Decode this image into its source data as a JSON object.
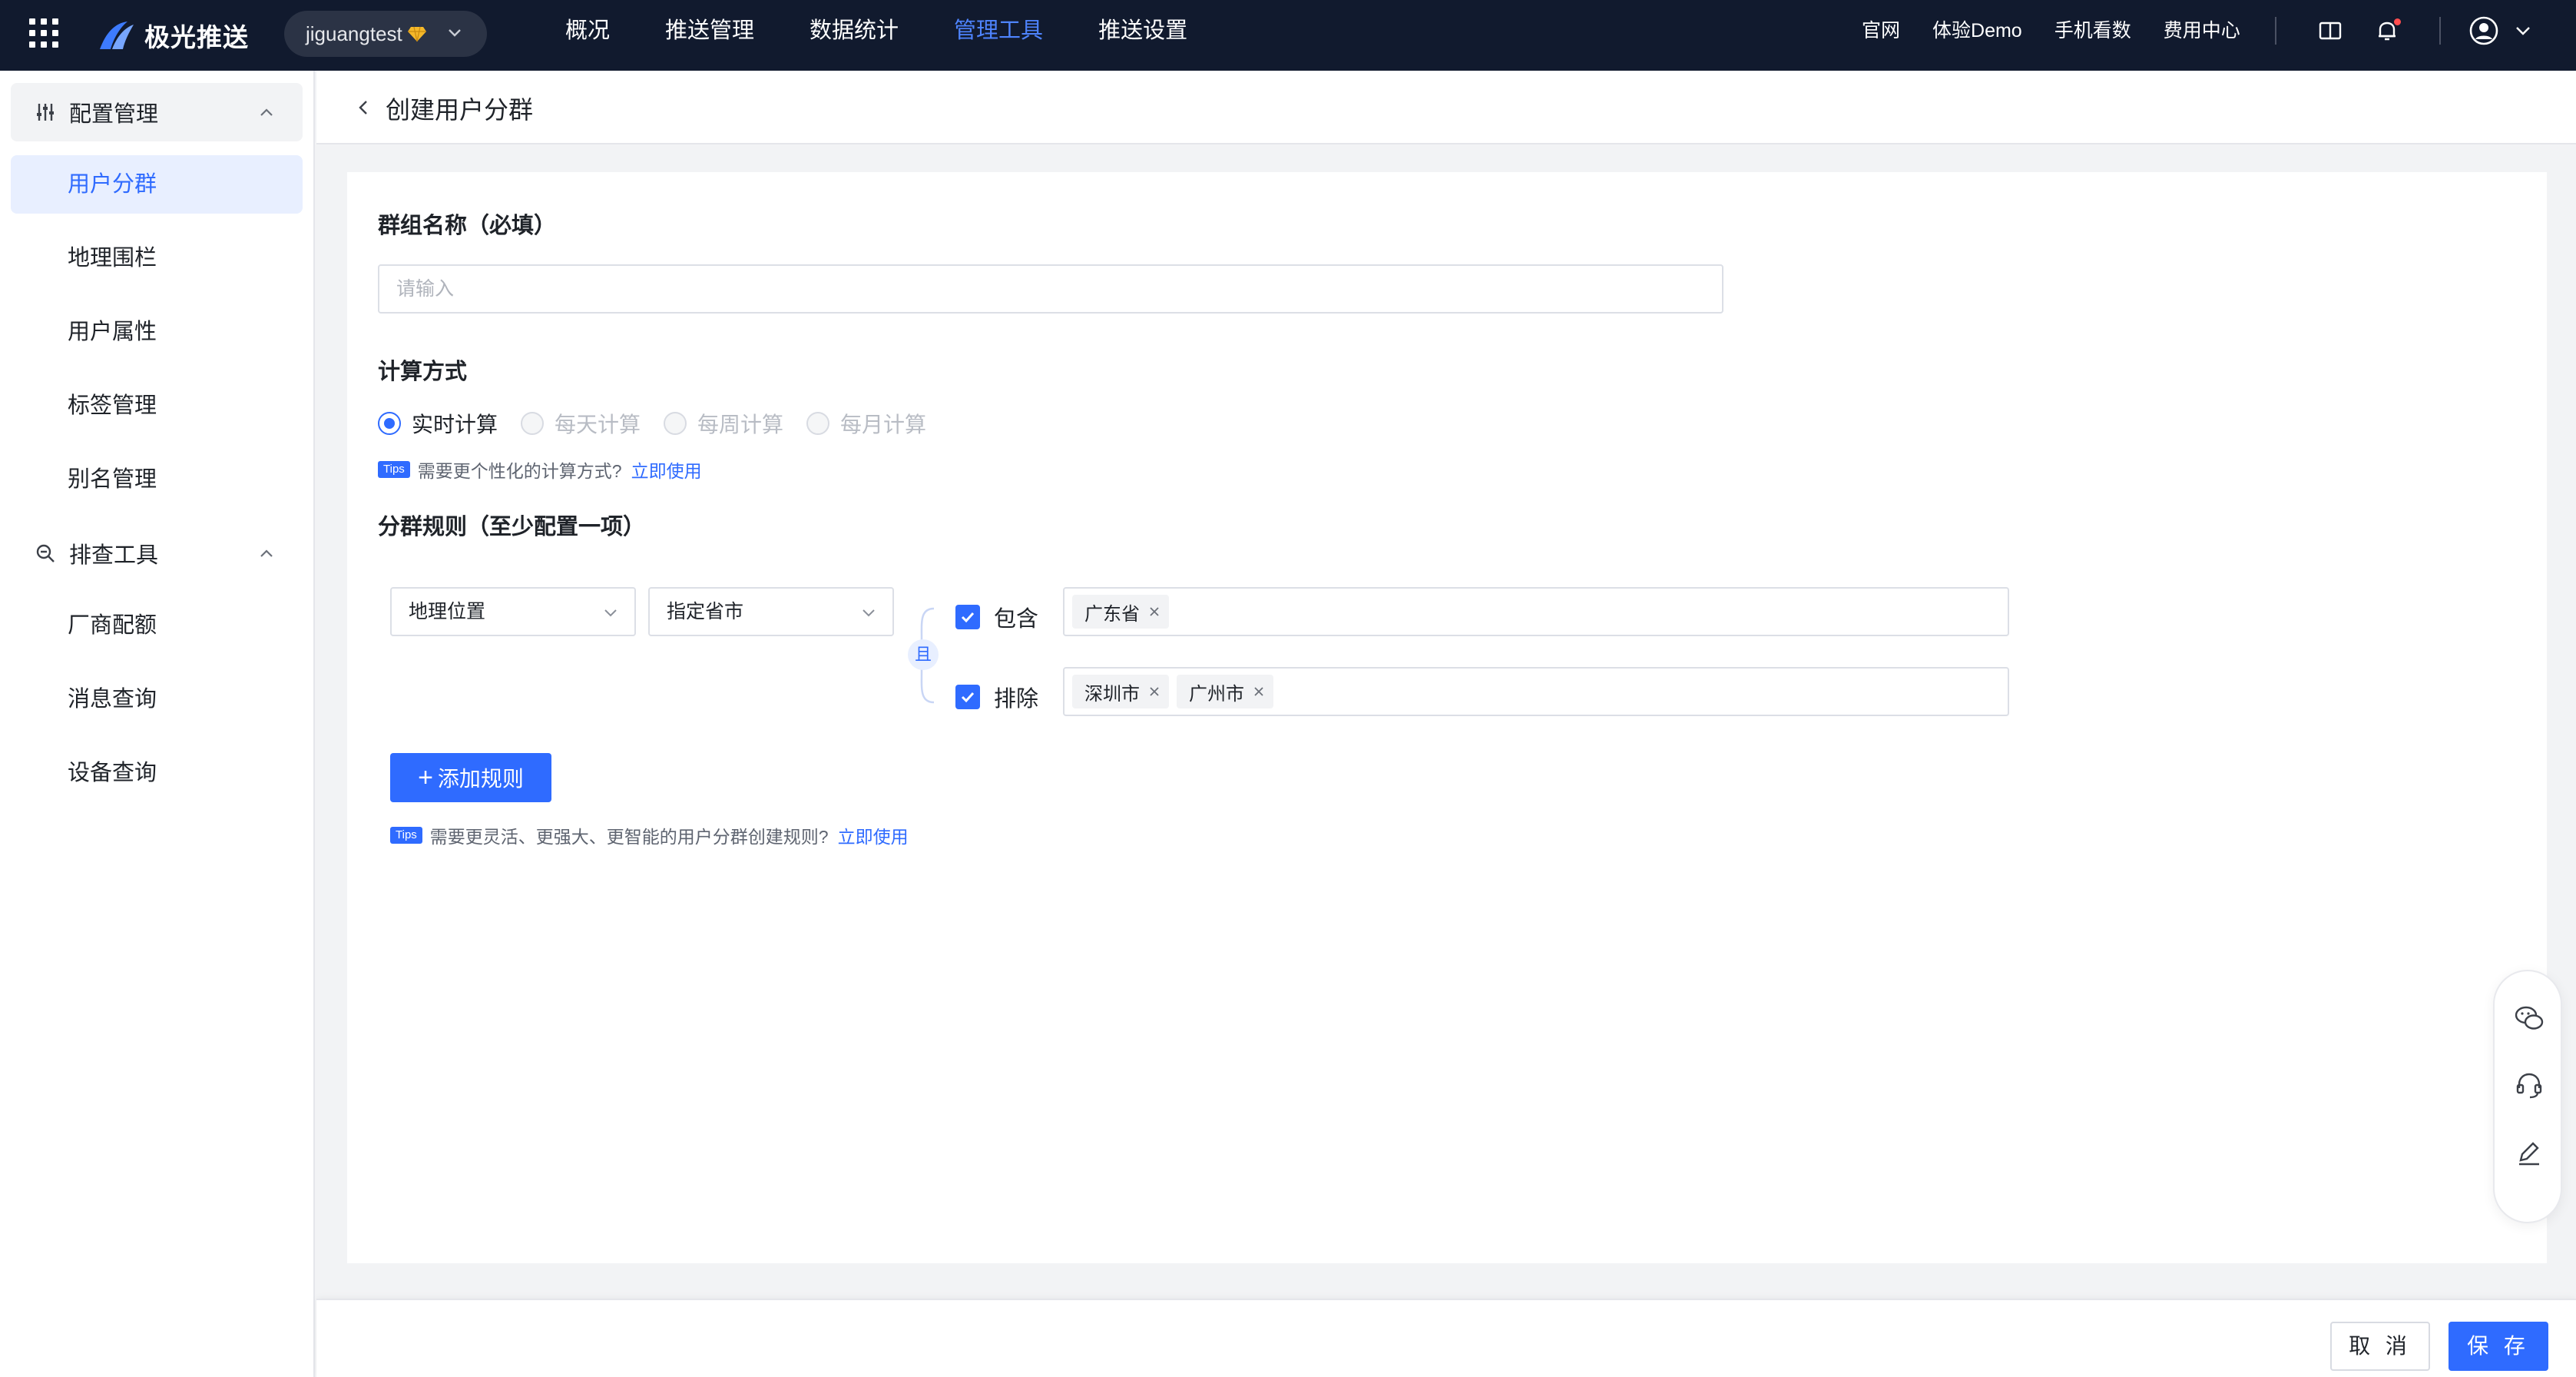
{
  "topbar": {
    "brand": "极光推送",
    "app_name": "jiguangtest",
    "nav": [
      "概况",
      "推送管理",
      "数据统计",
      "管理工具",
      "推送设置"
    ],
    "active_nav": "管理工具",
    "links": [
      "官网",
      "体验Demo",
      "手机看数",
      "费用中心"
    ]
  },
  "sidebar": {
    "group1": "配置管理",
    "group1_items": [
      "用户分群",
      "地理围栏",
      "用户属性",
      "标签管理",
      "别名管理"
    ],
    "group2": "排查工具",
    "group2_items": [
      "厂商配额",
      "消息查询",
      "设备查询"
    ],
    "active_item": "用户分群"
  },
  "header": {
    "title": "创建用户分群"
  },
  "form": {
    "name_label": "群组名称（必填）",
    "name_placeholder": "请输入",
    "calc_label": "计算方式",
    "calc_options": [
      "实时计算",
      "每天计算",
      "每周计算",
      "每月计算"
    ],
    "calc_selected": "实时计算",
    "tips_badge": "Tips",
    "calc_tip": "需要更个性化的计算方式?",
    "tip_link": "立即使用",
    "rules_label": "分群规则（至少配置一项）",
    "rule_field": "地理位置",
    "rule_subfield": "指定省市",
    "and_label": "且",
    "include_label": "包含",
    "include_tags": [
      "广东省"
    ],
    "exclude_label": "排除",
    "exclude_tags": [
      "深圳市",
      "广州市"
    ],
    "add_rule": "添加规则",
    "rules_tip": "需要更灵活、更强大、更智能的用户分群创建规则?"
  },
  "footer": {
    "cancel": "取 消",
    "save": "保 存"
  },
  "colors": {
    "accent": "#2f6bff",
    "topbar_bg": "#111a2e"
  }
}
